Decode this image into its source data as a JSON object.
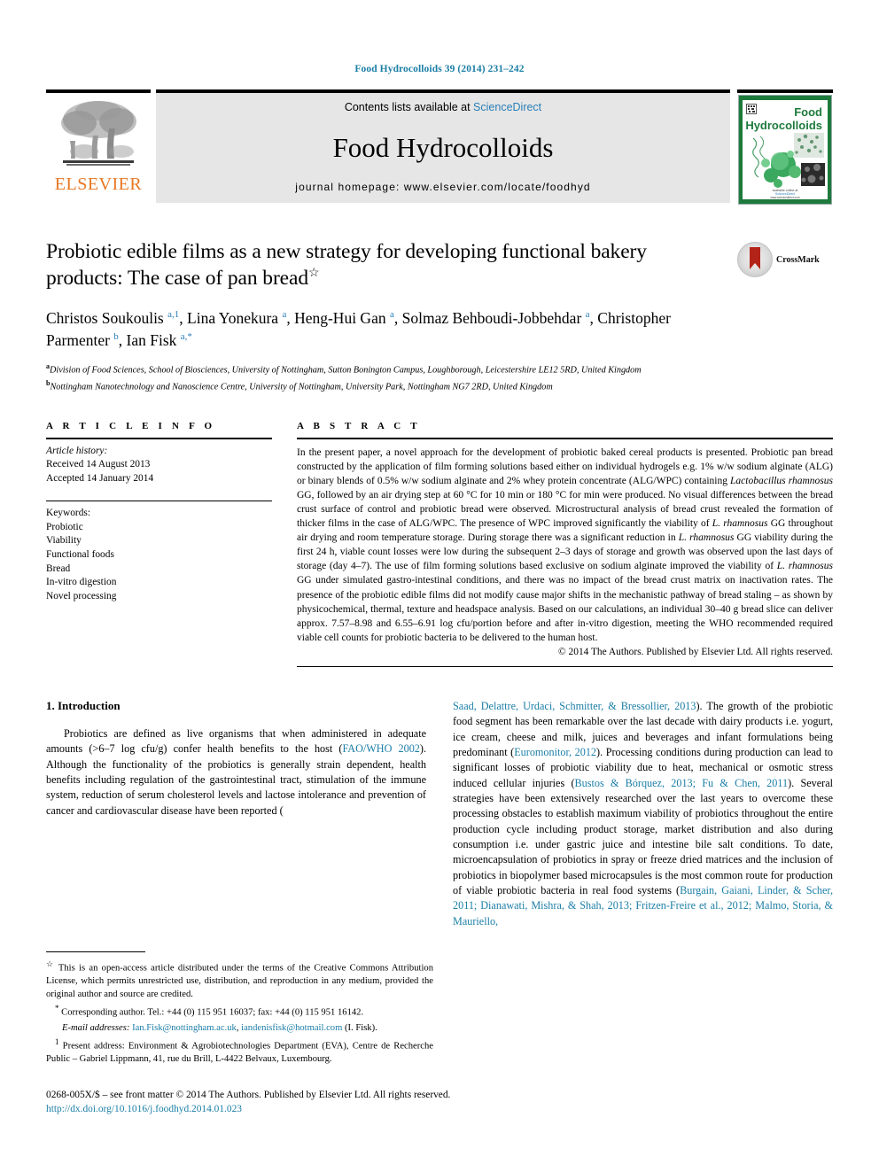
{
  "running_head": "Food Hydrocolloids 39 (2014) 231–242",
  "masthead": {
    "publisher_name": "ELSEVIER",
    "contents_prefix": "Contents lists available at ",
    "contents_link": "ScienceDirect",
    "journal_title": "Food Hydrocolloids",
    "homepage": "journal homepage: www.elsevier.com/locate/foodhyd",
    "cover_title_line1": "Food",
    "cover_title_line2": "Hydrocolloids"
  },
  "article": {
    "title": "Probiotic edible films as a new strategy for developing functional bakery products: The case of pan bread",
    "title_star": "☆",
    "crossmark_label": "CrossMark",
    "authors_html": "Christos Soukoulis <sup>a,1</sup>, Lina Yonekura <sup>a</sup>, Heng-Hui Gan <sup>a</sup>, Solmaz Behboudi-Jobbehdar <sup>a</sup>, Christopher Parmenter <sup>b</sup>, Ian Fisk <sup>a,*</sup>",
    "affiliation_a": "Division of Food Sciences, School of Biosciences, University of Nottingham, Sutton Bonington Campus, Loughborough, Leicestershire LE12 5RD, United Kingdom",
    "affiliation_b": "Nottingham Nanotechnology and Nanoscience Centre, University of Nottingham, University Park, Nottingham NG7 2RD, United Kingdom"
  },
  "article_info": {
    "heading": "A R T I C L E    I N F O",
    "history_label": "Article history:",
    "received": "Received 14 August 2013",
    "accepted": "Accepted 14 January 2014",
    "keywords_label": "Keywords:",
    "keywords": [
      "Probiotic",
      "Viability",
      "Functional foods",
      "Bread",
      "In-vitro digestion",
      "Novel processing"
    ]
  },
  "abstract": {
    "heading": "A B S T R A C T",
    "text": "In the present paper, a novel approach for the development of probiotic baked cereal products is presented. Probiotic pan bread constructed by the application of film forming solutions based either on individual hydrogels e.g. 1% w/w sodium alginate (ALG) or binary blends of 0.5% w/w sodium alginate and 2% whey protein concentrate (ALG/WPC) containing Lactobacillus rhamnosus GG, followed by an air drying step at 60 °C for 10 min or 180 °C for min were produced. No visual differences between the bread crust surface of control and probiotic bread were observed. Microstructural analysis of bread crust revealed the formation of thicker films in the case of ALG/WPC. The presence of WPC improved significantly the viability of L. rhamnosus GG throughout air drying and room temperature storage. During storage there was a significant reduction in L. rhamnosus GG viability during the first 24 h, viable count losses were low during the subsequent 2–3 days of storage and growth was observed upon the last days of storage (day 4–7). The use of film forming solutions based exclusive on sodium alginate improved the viability of L. rhamnosus GG under simulated gastro-intestinal conditions, and there was no impact of the bread crust matrix on inactivation rates. The presence of the probiotic edible films did not modify cause major shifts in the mechanistic pathway of bread staling – as shown by physicochemical, thermal, texture and headspace analysis. Based on our calculations, an individual 30–40 g bread slice can deliver approx. 7.57–8.98 and 6.55–6.91 log cfu/portion before and after in-vitro digestion, meeting the WHO recommended required viable cell counts for probiotic bacteria to be delivered to the human host.",
    "copyright": "© 2014 The Authors. Published by Elsevier Ltd. All rights reserved."
  },
  "introduction": {
    "section_number_title": "1.  Introduction",
    "paragraph_part1": "Probiotics are defined as live organisms that when administered in adequate amounts (>6–7 log cfu/g) confer health benefits to the host (",
    "cite_fao": "FAO/WHO 2002",
    "paragraph_part2": "). Although the functionality of the probiotics is generally strain dependent, health benefits including regulation of the gastrointestinal tract, stimulation of the immune system, reduction of serum cholesterol levels and lactose intolerance and prevention of cancer and cardiovascular disease have been reported (",
    "cite_saad": "Saad, Delattre, Urdaci, Schmitter, & Bressollier, 2013",
    "paragraph_part3": "). The growth of the probiotic food segment has been remarkable over the last decade with dairy products i.e. yogurt, ice cream, cheese and milk, juices and beverages and infant formulations being predominant (",
    "cite_euromonitor": "Euromonitor, 2012",
    "paragraph_part4": "). Processing conditions during production can lead to significant losses of probiotic viability due to heat, mechanical or osmotic stress induced cellular injuries (",
    "cite_bustos": "Bustos & Bórquez, 2013; Fu & Chen, 2011",
    "paragraph_part5": "). Several strategies have been extensively researched over the last years to overcome these processing obstacles to establish maximum viability of probiotics throughout the entire production cycle including product storage, market distribution and also during consumption i.e. under gastric juice and intestine bile salt conditions. To date, microencapsulation of probiotics in spray or freeze dried matrices and the inclusion of probiotics in biopolymer based microcapsules is the most common route for production of viable probiotic bacteria in real food systems (",
    "cite_burgain": "Burgain, Gaiani, Linder, & Scher, 2011; Dianawati, Mishra, & Shah, 2013; Fritzen-Freire et al., 2012; Malmo, Storia, & Mauriello,"
  },
  "footnotes": {
    "open_access_symbol": "☆",
    "open_access": "This is an open-access article distributed under the terms of the Creative Commons Attribution License, which permits unrestricted use, distribution, and reproduction in any medium, provided the original author and source are credited.",
    "corresponding_symbol": "*",
    "corresponding": "Corresponding author. Tel.: +44 (0) 115 951 16037; fax: +44 (0) 115 951 16142.",
    "email_label": "E-mail addresses:",
    "email_1": "Ian.Fisk@nottingham.ac.uk",
    "email_2": "iandenisfisk@hotmail.com",
    "email_suffix": "(I. Fisk).",
    "present_symbol": "1",
    "present_address": "Present address: Environment & Agrobiotechnologies Department (EVA), Centre de Recherche Public – Gabriel Lippmann, 41, rue du Brill, L-4422 Belvaux, Luxembourg."
  },
  "page_footer": {
    "front_matter": "0268-005X/$ – see front matter © 2014 The Authors. Published by Elsevier Ltd. All rights reserved.",
    "doi": "http://dx.doi.org/10.1016/j.foodhyd.2014.01.023"
  },
  "colors": {
    "link_blue": "#1b7ea6",
    "sciencedirect_blue": "#2a7fb8",
    "elsevier_orange": "#E87722",
    "cover_green": "#1e7a3c",
    "crossmark_red": "#b42318"
  }
}
